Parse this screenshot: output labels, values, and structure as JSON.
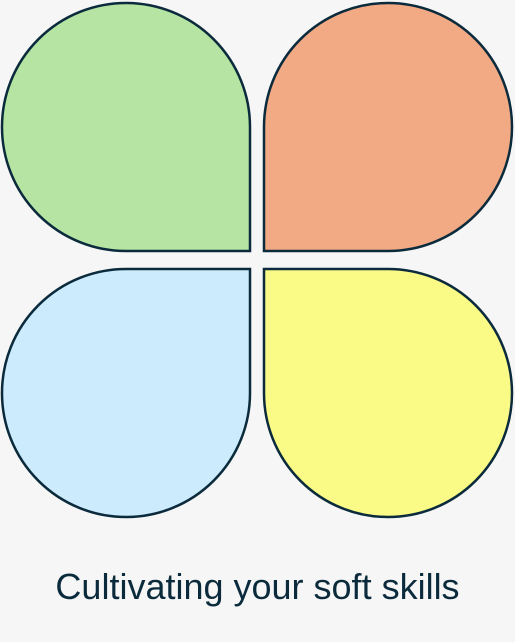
{
  "diagram": {
    "caption": "Cultivating your soft skills",
    "petals": [
      {
        "name": "top-left-petal",
        "fill": "#b6e5a3"
      },
      {
        "name": "top-right-petal",
        "fill": "#f2aa84"
      },
      {
        "name": "bottom-left-petal",
        "fill": "#ccecfd"
      },
      {
        "name": "bottom-right-petal",
        "fill": "#fafa86"
      }
    ],
    "stroke_color": "#0b2b3c",
    "background": "#f6f6f6"
  }
}
